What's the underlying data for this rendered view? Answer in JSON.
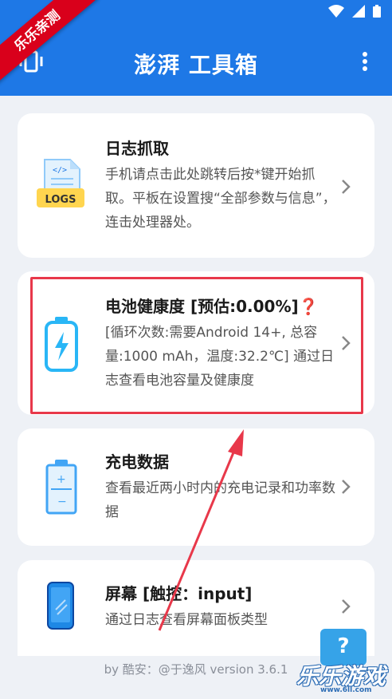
{
  "ribbon": {
    "label": "乐乐亲测"
  },
  "appbar": {
    "title": "澎湃 工具箱"
  },
  "cards": [
    {
      "title": "日志抓取",
      "desc": "手机请点击此处跳转后按*键开始抓取。平板在设置搜“全部参数与信息”，连击处理器处。",
      "icon": "logs-document-icon",
      "icon_label": "LOGS"
    },
    {
      "title": "电池健康度 [预估:0.00%]",
      "desc": "[循环次数:需要Android 14+, 总容量:1000 mAh，温度:32.2℃] 通过日志查看电池容量及健康度",
      "icon": "battery-bolt-icon",
      "emoji": "❓"
    },
    {
      "title": "充电数据",
      "desc": "查看最近两小时内的充电记录和功率数据",
      "icon": "battery-charge-icon"
    },
    {
      "title": "屏幕 [触控：input]",
      "desc": "通过日志查看屏幕面板类型",
      "icon": "phone-screen-icon"
    }
  ],
  "footer": {
    "text": "by 酷安：@于逸风 version 3.6.1"
  },
  "help": {
    "label": "?"
  },
  "watermark": {
    "text": "乐乐游戏",
    "sub": "www.6ll.com"
  },
  "colors": {
    "primary": "#1e78e6",
    "highlight": "#e8384a",
    "accent_cyan": "#29b6f6"
  }
}
